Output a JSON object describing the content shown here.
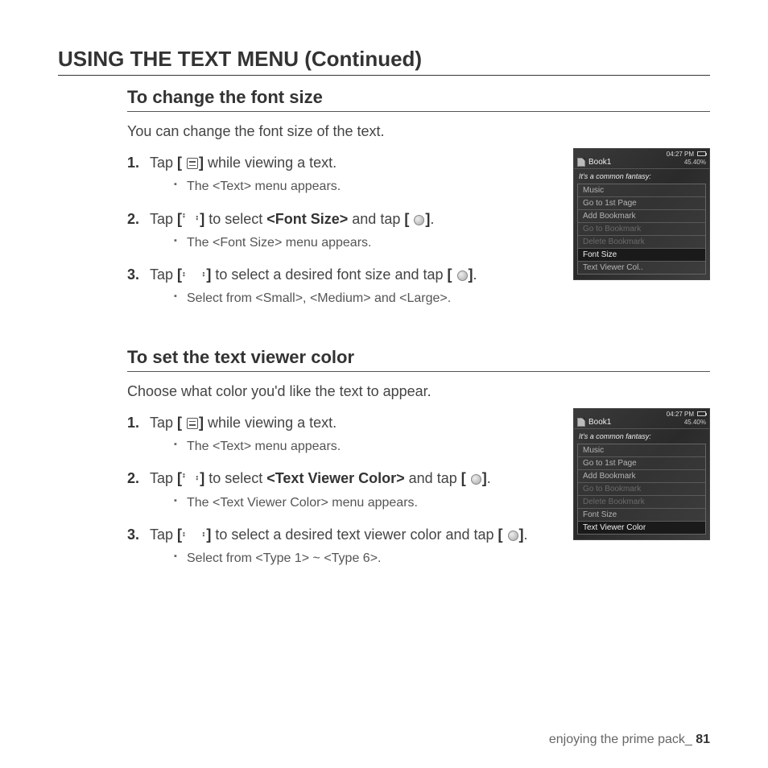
{
  "page_title": "USING THE TEXT MENU (Continued)",
  "section1": {
    "heading": "To change the font size",
    "intro": "You can change the font size of the text.",
    "step1_a": "Tap ",
    "step1_b": " while viewing a text.",
    "step1_note": "The <Text> menu appears.",
    "step2_a": "Tap ",
    "step2_b": " to select ",
    "step2_bold": "<Font Size>",
    "step2_c": " and tap ",
    "step2_d": ".",
    "step2_note": "The <Font Size> menu appears.",
    "step3_a": "Tap ",
    "step3_b": " to select a desired font size and tap ",
    "step3_c": ".",
    "step3_note": "Select from <Small>, <Medium> and <Large>."
  },
  "section2": {
    "heading": "To set the text viewer color",
    "intro": "Choose what color you'd like the text to appear.",
    "step1_a": "Tap ",
    "step1_b": " while viewing a text.",
    "step1_note": "The <Text> menu appears.",
    "step2_a": "Tap ",
    "step2_b": " to select ",
    "step2_bold": "<Text Viewer Color>",
    "step2_c": " and tap ",
    "step2_d": ".",
    "step2_note": "The <Text Viewer Color> menu appears.",
    "step3_a": "Tap ",
    "step3_b": " to select a desired text viewer color and tap ",
    "step3_c": ".",
    "step3_note": "Select from <Type 1> ~ <Type 6>."
  },
  "device1": {
    "time": "04:27 PM",
    "title": "Book1",
    "pct": "45.40%",
    "body": "It's a common fantasy:",
    "menu": [
      "Music",
      "Go to 1st Page",
      "Add Bookmark",
      "Go to Bookmark",
      "Delete Bookmark",
      "Font Size",
      "Text Viewer Col.."
    ],
    "dim_idx": [
      3,
      4
    ],
    "sel_idx": 5
  },
  "device2": {
    "time": "04:27 PM",
    "title": "Book1",
    "pct": "45.40%",
    "body": "It's a common fantasy:",
    "menu": [
      "Music",
      "Go to 1st Page",
      "Add Bookmark",
      "Go to Bookmark",
      "Delete Bookmark",
      "Font Size",
      "Text Viewer Color"
    ],
    "dim_idx": [
      3,
      4
    ],
    "sel_idx": 6
  },
  "bracket_open": "[",
  "bracket_close": "]",
  "footer_text": "enjoying the prime pack_ ",
  "footer_page": "81"
}
